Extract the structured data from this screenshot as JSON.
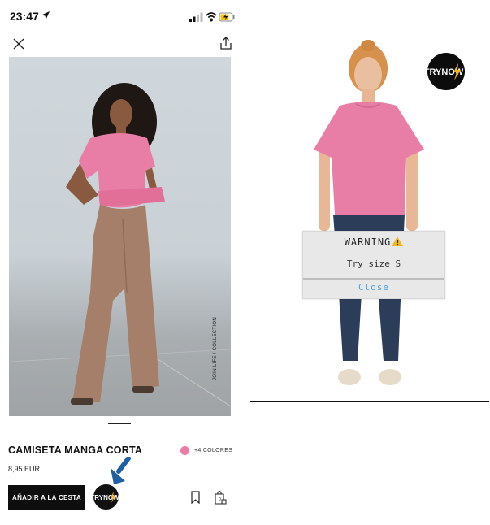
{
  "status_bar": {
    "time": "23:47"
  },
  "product": {
    "name": "CAMISETA MANGA CORTA",
    "price": "8,95 EUR",
    "more_colors": "+4 COLORES",
    "swatch_color": "#ee7aa8",
    "add_to_cart": "AÑADIR A LA CESTA",
    "photo_caption": "JOIN LIFE / COLLECTION"
  },
  "trynow": {
    "logo_text": "TRYNOW"
  },
  "tryon_dialog": {
    "title": "WARNING",
    "message": "Try size S",
    "close": "Close"
  },
  "icons": [
    "location-arrow-icon",
    "signal-icon",
    "wifi-icon",
    "battery-icon",
    "close-icon",
    "share-icon",
    "bookmark-icon",
    "shopping-bag-icon",
    "lightning-icon",
    "warning-icon"
  ],
  "colors": {
    "tshirt_pink": "#e87ea6",
    "accent_blue": "#1f5fa3",
    "close_link": "#4da3e0"
  }
}
